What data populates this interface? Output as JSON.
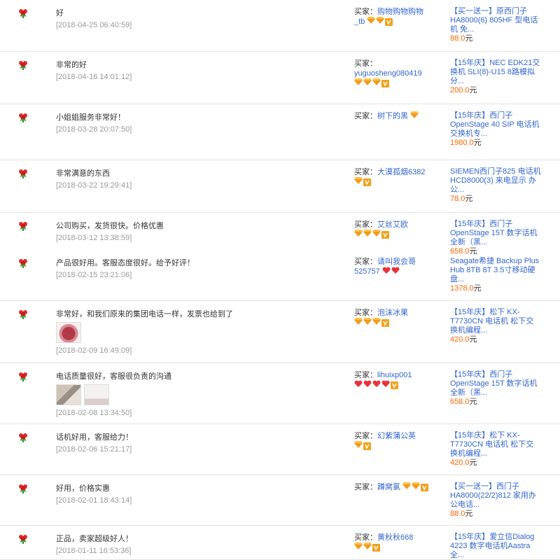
{
  "labels": {
    "buyer": "买家：",
    "currency": "元"
  },
  "reviews": [
    {
      "comment": "好",
      "date": "[2018-04-25 06:40:59]",
      "buyer": "购物购物购物_tb",
      "badges": [
        "diamond",
        "diamond",
        "vip"
      ],
      "product": "【买一送一】原西门子HA8000(6) 805HF 型电话机 免...",
      "price": "88.0"
    },
    {
      "comment": "非常的好",
      "date": "[2018-04-16 14:01:12]",
      "buyer": "yuguosheng080419",
      "badges": [
        "diamond",
        "diamond",
        "diamond",
        "vip"
      ],
      "product": "【15年庆】NEC EDK21交换机 SLI(8)-U15 8路模拟分...",
      "price": "200.0"
    },
    {
      "comment": "小姐姐服务非常好！",
      "date": "[2018-03-28 20:07:50]",
      "buyer": "树下的黑",
      "badges": [
        "diamond"
      ],
      "product": "【15年庆】西门子OpenStage 40 SIP 电话机 交换机专...",
      "price": "1980.0"
    },
    {
      "comment": "非常满意的东西",
      "date": "[2018-03-22 19:29:41]",
      "buyer": "大漠孤烟6382",
      "badges": [
        "diamond",
        "vip"
      ],
      "product": "SIEMEN西门子825 电话机 HCD8000(3) 来电显示 办公...",
      "price": "78.0"
    },
    {
      "comment": "公司购买，发货很快。价格优惠",
      "date": "[2018-03-12 13:38:59]",
      "buyer": "艾丝艾欧",
      "badges": [
        "diamond",
        "diamond",
        "diamond",
        "vip"
      ],
      "product": "【15年庆】西门子OpenStage 15T 数字话机 全新（黑...",
      "price": "658.0"
    },
    {
      "comment": "产品很好用。客服态度很好。给予好评！",
      "date": "[2018-02-15 23:21:06]",
      "buyer": "请叫我会哥525757",
      "badges": [
        "heart",
        "heart"
      ],
      "product": "Seagate希捷 Backup Plus Hub 8TB 8T 3.5寸移动硬盘...",
      "price": "1378.0"
    },
    {
      "comment": "非常好，和我们原来的集团电话一样，发票也给到了",
      "date": "[2018-02-09 16:49:09]",
      "buyer": "泡沫冰果",
      "badges": [
        "diamond",
        "diamond",
        "diamond",
        "vip"
      ],
      "product": "【15年庆】松下 KX-T7730CN 电话机 松下交换机编程...",
      "price": "420.0",
      "thumbs": [
        "cake"
      ]
    },
    {
      "comment": "电话质量很好，客服很负责的沟通",
      "date": "[2018-02-08 13:34:50]",
      "buyer": "lihuixp001",
      "badges": [
        "heart",
        "heart",
        "heart",
        "heart",
        "vip"
      ],
      "product": "【15年庆】西门子OpenStage 15T 数字话机 全新（黑...",
      "price": "658.0",
      "thumbs": [
        "photo1",
        "photo2"
      ]
    },
    {
      "comment": "话机好用，客服给力！",
      "date": "[2018-02-06 15:21:17]",
      "buyer": "幻紫蒲公英",
      "badges": [
        "diamond",
        "vip"
      ],
      "product": "【15年庆】松下 KX-T7730CN 电话机 松下交换机编程...",
      "price": "420.0"
    },
    {
      "comment": "好用，价格实惠",
      "date": "[2018-02-01 18:43:14]",
      "buyer": "蹲窝氯",
      "badges": [
        "diamond",
        "diamond",
        "vip"
      ],
      "product": "【买一送一】西门子HA8000(22/2)812 家用办公电话...",
      "price": "88.0"
    },
    {
      "comment": "正品，卖家超级好人！",
      "date": "[2018-01-11 16:53:36]",
      "buyer": "黄秋秋668",
      "badges": [
        "diamond",
        "diamond",
        "vip"
      ],
      "product": "【15年庆】爱立信Dialog 4223 数字电话机Aastra 全...",
      "price": ""
    }
  ]
}
